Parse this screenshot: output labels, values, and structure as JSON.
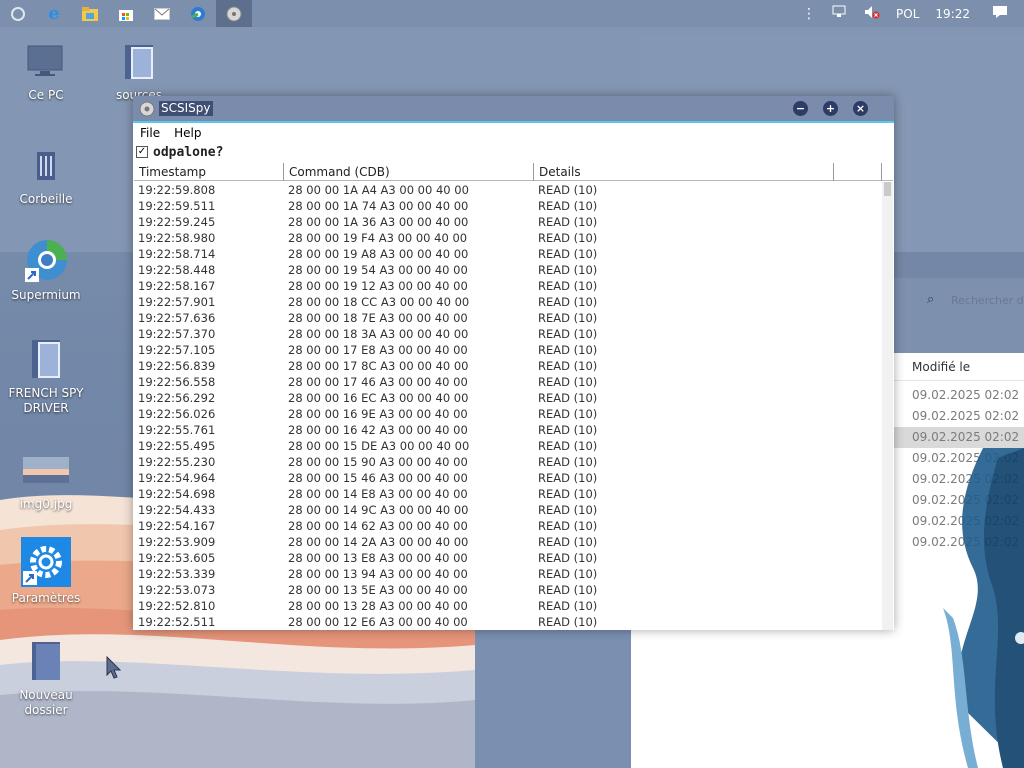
{
  "taskbar": {
    "language": "POL",
    "clock": "19:22",
    "left_icons": [
      "start-orb-icon",
      "edge-icon",
      "file-explorer-icon",
      "store-icon",
      "mail-icon",
      "browser-icon",
      "scsispy-icon"
    ],
    "right_icons": [
      "chevron-up-icon",
      "network-icon",
      "volume-muted-icon",
      "notifications-icon"
    ]
  },
  "desktop": {
    "icons": [
      {
        "label": "Ce PC",
        "icon": "computer-icon"
      },
      {
        "label": "sources",
        "icon": "folder-icon"
      },
      {
        "label": "Corbeille",
        "icon": "recycle-bin-icon"
      },
      {
        "label": "Supermium",
        "icon": "supermium-icon"
      },
      {
        "label": "FRENCH SPY DRIVER",
        "icon": "folder-icon"
      },
      {
        "label": "img0.jpg",
        "icon": "image-file-icon"
      },
      {
        "label": "Paramètres",
        "icon": "settings-icon"
      },
      {
        "label": "Nouveau dossier",
        "icon": "folder-icon"
      }
    ]
  },
  "explorer": {
    "search_placeholder": "Rechercher d...",
    "column_header": "Modifié le",
    "dates": [
      "09.02.2025 02:02",
      "09.02.2025 02:02",
      "09.02.2025 02:02",
      "09.02.2025 02:02",
      "09.02.2025 02:02",
      "09.02.2025 02:02",
      "09.02.2025 02:02",
      "09.02.2025 02:02"
    ],
    "selected_index": 2
  },
  "scsispy": {
    "title": "SCSISpy",
    "menu": {
      "file": "File",
      "help": "Help"
    },
    "checkbox": {
      "label": "odpalone?",
      "checked": true,
      "mark": "✓"
    },
    "columns": {
      "timestamp": "Timestamp",
      "command": "Command (CDB)",
      "details": "Details",
      "extra": ""
    },
    "rows": [
      {
        "time": "19:22:59.808",
        "cdb": "28 00 00 1A A4 A3 00 00 40 00",
        "details": "READ (10)"
      },
      {
        "time": "19:22:59.511",
        "cdb": "28 00 00 1A 74 A3 00 00 40 00",
        "details": "READ (10)"
      },
      {
        "time": "19:22:59.245",
        "cdb": "28 00 00 1A 36 A3 00 00 40 00",
        "details": "READ (10)"
      },
      {
        "time": "19:22:58.980",
        "cdb": "28 00 00 19 F4 A3 00 00 40 00",
        "details": "READ (10)"
      },
      {
        "time": "19:22:58.714",
        "cdb": "28 00 00 19 A8 A3 00 00 40 00",
        "details": "READ (10)"
      },
      {
        "time": "19:22:58.448",
        "cdb": "28 00 00 19 54 A3 00 00 40 00",
        "details": "READ (10)"
      },
      {
        "time": "19:22:58.167",
        "cdb": "28 00 00 19 12 A3 00 00 40 00",
        "details": "READ (10)"
      },
      {
        "time": "19:22:57.901",
        "cdb": "28 00 00 18 CC A3 00 00 40 00",
        "details": "READ (10)"
      },
      {
        "time": "19:22:57.636",
        "cdb": "28 00 00 18 7E A3 00 00 40 00",
        "details": "READ (10)"
      },
      {
        "time": "19:22:57.370",
        "cdb": "28 00 00 18 3A A3 00 00 40 00",
        "details": "READ (10)"
      },
      {
        "time": "19:22:57.105",
        "cdb": "28 00 00 17 E8 A3 00 00 40 00",
        "details": "READ (10)"
      },
      {
        "time": "19:22:56.839",
        "cdb": "28 00 00 17 8C A3 00 00 40 00",
        "details": "READ (10)"
      },
      {
        "time": "19:22:56.558",
        "cdb": "28 00 00 17 46 A3 00 00 40 00",
        "details": "READ (10)"
      },
      {
        "time": "19:22:56.292",
        "cdb": "28 00 00 16 EC A3 00 00 40 00",
        "details": "READ (10)"
      },
      {
        "time": "19:22:56.026",
        "cdb": "28 00 00 16 9E A3 00 00 40 00",
        "details": "READ (10)"
      },
      {
        "time": "19:22:55.761",
        "cdb": "28 00 00 16 42 A3 00 00 40 00",
        "details": "READ (10)"
      },
      {
        "time": "19:22:55.495",
        "cdb": "28 00 00 15 DE A3 00 00 40 00",
        "details": "READ (10)"
      },
      {
        "time": "19:22:55.230",
        "cdb": "28 00 00 15 90 A3 00 00 40 00",
        "details": "READ (10)"
      },
      {
        "time": "19:22:54.964",
        "cdb": "28 00 00 15 46 A3 00 00 40 00",
        "details": "READ (10)"
      },
      {
        "time": "19:22:54.698",
        "cdb": "28 00 00 14 E8 A3 00 00 40 00",
        "details": "READ (10)"
      },
      {
        "time": "19:22:54.433",
        "cdb": "28 00 00 14 9C A3 00 00 40 00",
        "details": "READ (10)"
      },
      {
        "time": "19:22:54.167",
        "cdb": "28 00 00 14 62 A3 00 00 40 00",
        "details": "READ (10)"
      },
      {
        "time": "19:22:53.909",
        "cdb": "28 00 00 14 2A A3 00 00 40 00",
        "details": "READ (10)"
      },
      {
        "time": "19:22:53.605",
        "cdb": "28 00 00 13 E8 A3 00 00 40 00",
        "details": "READ (10)"
      },
      {
        "time": "19:22:53.339",
        "cdb": "28 00 00 13 94 A3 00 00 40 00",
        "details": "READ (10)"
      },
      {
        "time": "19:22:53.073",
        "cdb": "28 00 00 13 5E A3 00 00 40 00",
        "details": "READ (10)"
      },
      {
        "time": "19:22:52.810",
        "cdb": "28 00 00 13 28 A3 00 00 40 00",
        "details": "READ (10)"
      },
      {
        "time": "19:22:52.511",
        "cdb": "28 00 00 12 E6 A3 00 00 40 00",
        "details": "READ (10)"
      }
    ]
  },
  "colors": {
    "taskbar": "#7c8fad",
    "titlebar": "#7a8bab",
    "accent": "#58c8ef",
    "title_highlight": "#3f4f73",
    "window_controls": "#2d3b66"
  }
}
